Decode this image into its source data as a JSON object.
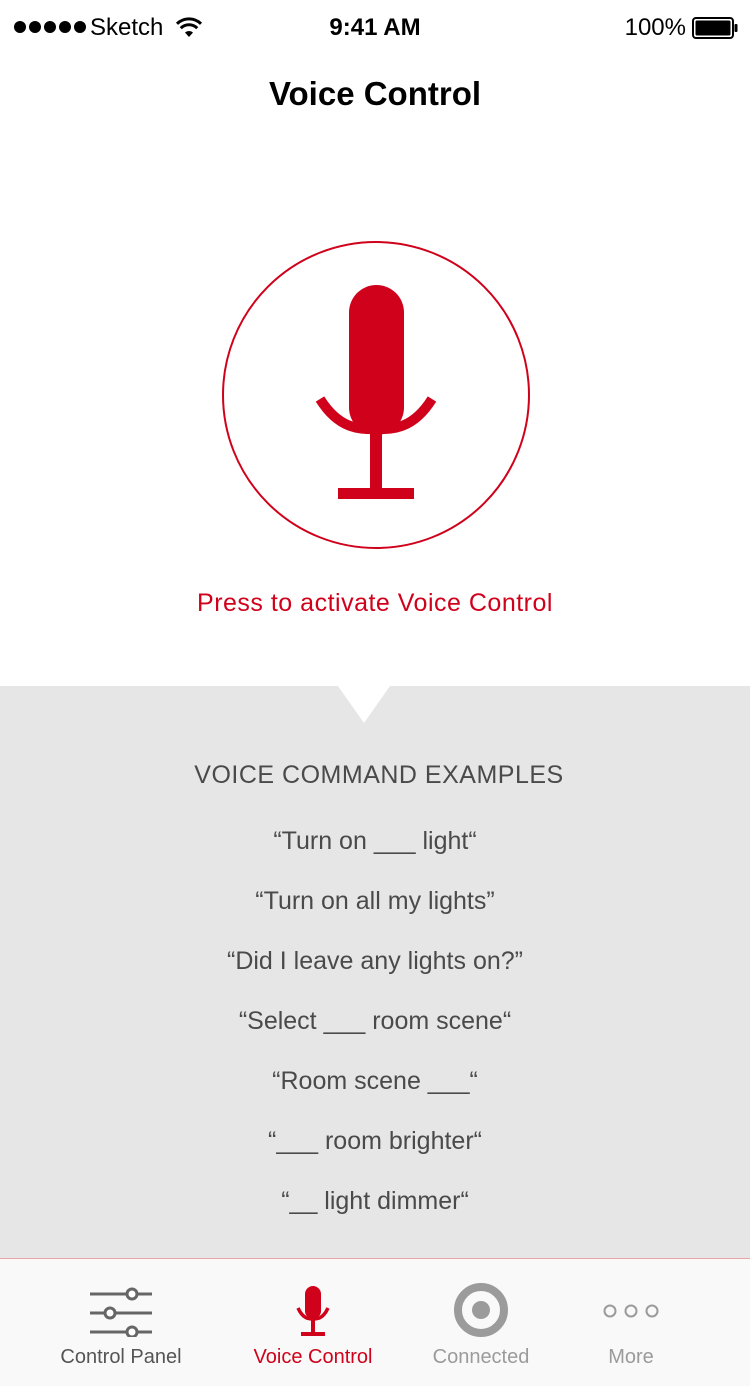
{
  "status_bar": {
    "carrier": "Sketch",
    "time": "9:41 AM",
    "battery": "100%"
  },
  "nav": {
    "title": "Voice Control"
  },
  "mic": {
    "activate_text": "Press to activate Voice Control"
  },
  "examples": {
    "heading": "VOICE COMMAND EXAMPLES",
    "items": [
      "“Turn on ___ light“",
      "“Turn on all my lights”",
      "“Did I leave any lights on?”",
      "“Select ___ room scene“",
      "“Room scene ___“",
      "“___ room brighter“",
      "“__ light dimmer“"
    ]
  },
  "tab_bar": {
    "tabs": [
      {
        "label": "Control Panel",
        "icon": "sliders-icon",
        "active": false
      },
      {
        "label": "Voice Control",
        "icon": "microphone-icon",
        "active": true
      },
      {
        "label": "Connected",
        "icon": "target-icon",
        "active": false
      },
      {
        "label": "More",
        "icon": "ellipsis-icon",
        "active": false
      }
    ]
  },
  "colors": {
    "accent": "#d0021b",
    "panel_background": "#e6e6e6",
    "text_gray": "#4a4a4a",
    "inactive_gray": "#9b9b9b"
  }
}
